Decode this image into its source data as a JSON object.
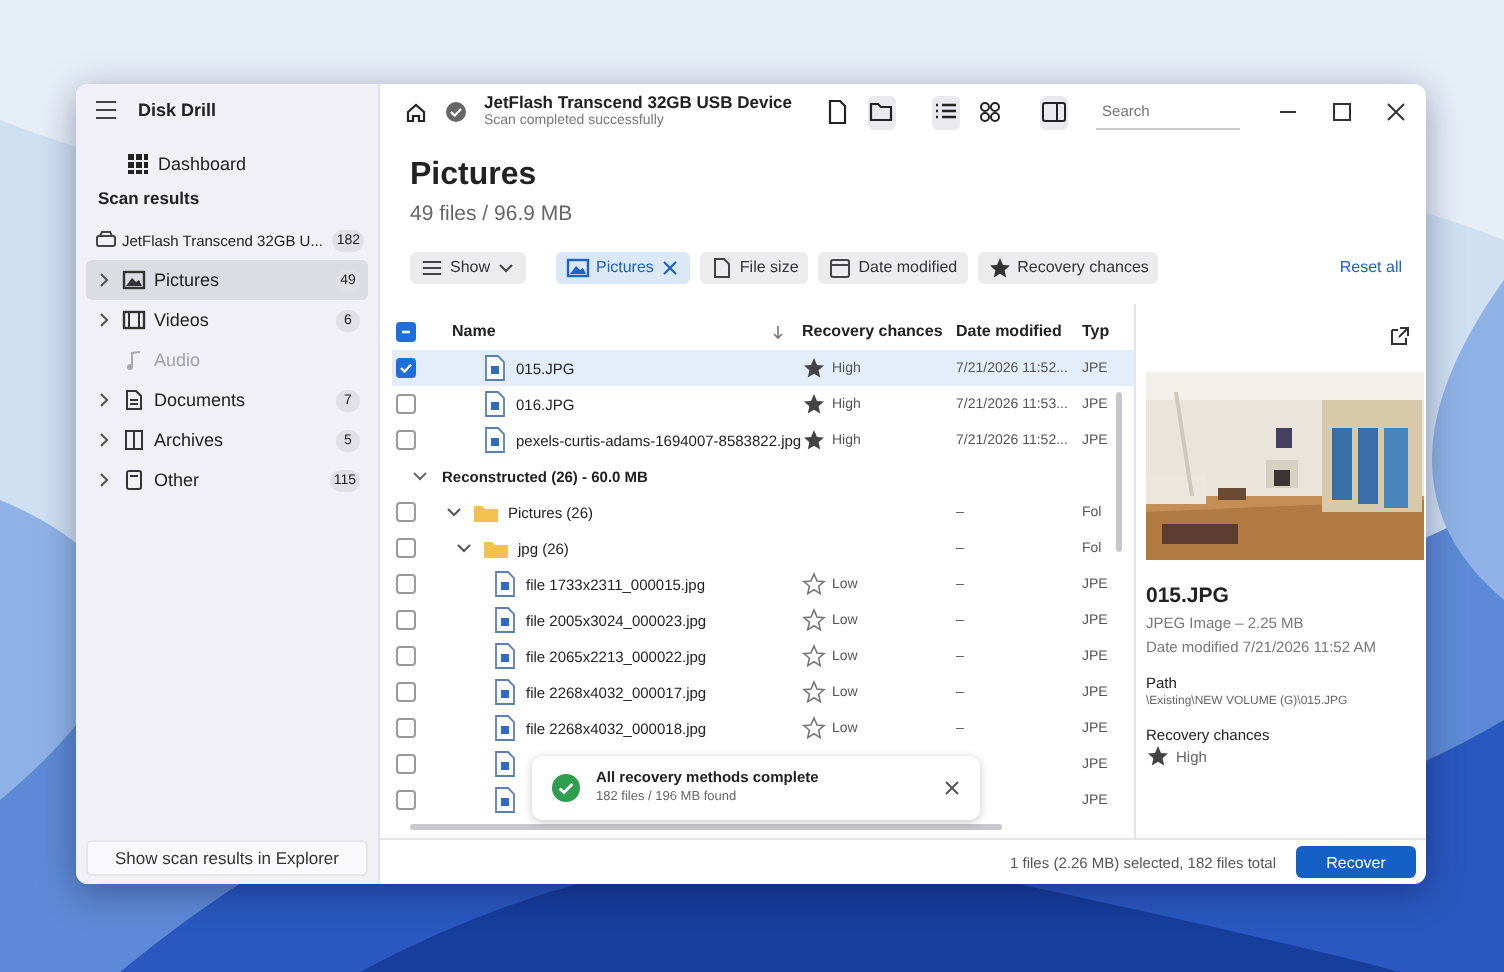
{
  "window": {
    "title": "Disk Drill"
  },
  "sidebar": {
    "dashboard": "Dashboard",
    "section": "Scan results",
    "device": {
      "label": "JetFlash Transcend 32GB U...",
      "count": "182"
    },
    "categories": [
      {
        "kind": "pictures",
        "label": "Pictures",
        "count": "49",
        "selected": true,
        "disabled": false
      },
      {
        "kind": "videos",
        "label": "Videos",
        "count": "6",
        "selected": false,
        "disabled": false
      },
      {
        "kind": "audio",
        "label": "Audio",
        "selected": false,
        "disabled": true
      },
      {
        "kind": "documents",
        "label": "Documents",
        "count": "7",
        "selected": false,
        "disabled": false
      },
      {
        "kind": "archives",
        "label": "Archives",
        "count": "5",
        "selected": false,
        "disabled": false
      },
      {
        "kind": "other",
        "label": "Other",
        "count": "115",
        "selected": false,
        "disabled": false
      }
    ],
    "footer_button": "Show scan results in Explorer"
  },
  "header": {
    "device": "JetFlash Transcend 32GB USB Device",
    "status": "Scan completed successfully",
    "tools": [
      {
        "kind": "file",
        "selected": false
      },
      {
        "kind": "folder",
        "selected": true
      },
      {
        "kind": "list",
        "selected": true
      },
      {
        "kind": "grid",
        "selected": false
      },
      {
        "kind": "panel",
        "selected": true
      }
    ],
    "search": {
      "placeholder": "Search"
    }
  },
  "page": {
    "title": "Pictures",
    "summary": "49 files / 96.9 MB"
  },
  "filters": [
    {
      "kind": "show",
      "label": "Show",
      "selected": false
    },
    {
      "kind": "pictures",
      "label": "Pictures",
      "selected": true
    },
    {
      "kind": "size",
      "label": "File size",
      "selected": false
    },
    {
      "kind": "date",
      "label": "Date modified",
      "selected": false
    },
    {
      "kind": "chance",
      "label": "Recovery chances",
      "selected": false
    }
  ],
  "reset": "Reset all",
  "table": {
    "columns": [
      "Name",
      "Recovery chances",
      "Date modified",
      "Typ"
    ],
    "partially_checked": true,
    "rows": [
      {
        "kind": "file",
        "name": "015.JPG",
        "chance": "High",
        "star_filled": true,
        "date": "7/21/2026 11:52...",
        "type": "JPE",
        "checked": true,
        "selected": true
      },
      {
        "kind": "file",
        "name": "016.JPG",
        "chance": "High",
        "star_filled": true,
        "date": "7/21/2026 11:53...",
        "type": "JPE",
        "checked": false,
        "selected": false
      },
      {
        "kind": "file",
        "name": "pexels-curtis-adams-1694007-8583822.jpg",
        "chance": "High",
        "star_filled": true,
        "date": "7/21/2026 11:52...",
        "type": "JPE",
        "checked": false,
        "selected": false
      },
      {
        "kind": "group",
        "name": "Reconstructed (26) - 60.0 MB",
        "expanded": true,
        "children": [
          {
            "kind": "folder",
            "name": "Pictures (26)",
            "date": "–",
            "type": "Fol",
            "checked": false,
            "selected": false,
            "expanded": true,
            "children": [
              {
                "kind": "folder",
                "name": "jpg (26)",
                "date": "–",
                "type": "Fol",
                "checked": false,
                "selected": false,
                "expanded": true,
                "children": [
                  {
                    "kind": "file",
                    "name": "file 1733x2311_000015.jpg",
                    "chance": "Low",
                    "star_filled": false,
                    "date": "–",
                    "type": "JPE",
                    "checked": false,
                    "selected": false
                  },
                  {
                    "kind": "file",
                    "name": "file 2005x3024_000023.jpg",
                    "chance": "Low",
                    "star_filled": false,
                    "date": "–",
                    "type": "JPE",
                    "checked": false,
                    "selected": false
                  },
                  {
                    "kind": "file",
                    "name": "file 2065x2213_000022.jpg",
                    "chance": "Low",
                    "star_filled": false,
                    "date": "–",
                    "type": "JPE",
                    "checked": false,
                    "selected": false
                  },
                  {
                    "kind": "file",
                    "name": "file 2268x4032_000017.jpg",
                    "chance": "Low",
                    "star_filled": false,
                    "date": "–",
                    "type": "JPE",
                    "checked": false,
                    "selected": false
                  },
                  {
                    "kind": "file",
                    "name": "file 2268x4032_000018.jpg",
                    "chance": "Low",
                    "star_filled": false,
                    "date": "–",
                    "type": "JPE",
                    "checked": false,
                    "selected": false
                  },
                  {
                    "kind": "file",
                    "type": "JPE",
                    "checked": false,
                    "selected": false
                  },
                  {
                    "kind": "file",
                    "type": "JPE",
                    "checked": false,
                    "selected": false
                  }
                ]
              }
            ]
          }
        ]
      }
    ]
  },
  "toast": {
    "title": "All recovery methods complete",
    "detail": "182 files / 196 MB found"
  },
  "details": {
    "title": "015.JPG",
    "info": "JPEG Image – 2.25 MB",
    "date": "Date modified 7/21/2026 11:52 AM",
    "path_label": "Path",
    "path": "\\Existing\\NEW VOLUME (G)\\015.JPG",
    "chance_label": "Recovery chances",
    "chance": "High",
    "star_filled": true
  },
  "status": {
    "text": "1 files (2.26 MB) selected, 182 files total",
    "button": "Recover"
  }
}
